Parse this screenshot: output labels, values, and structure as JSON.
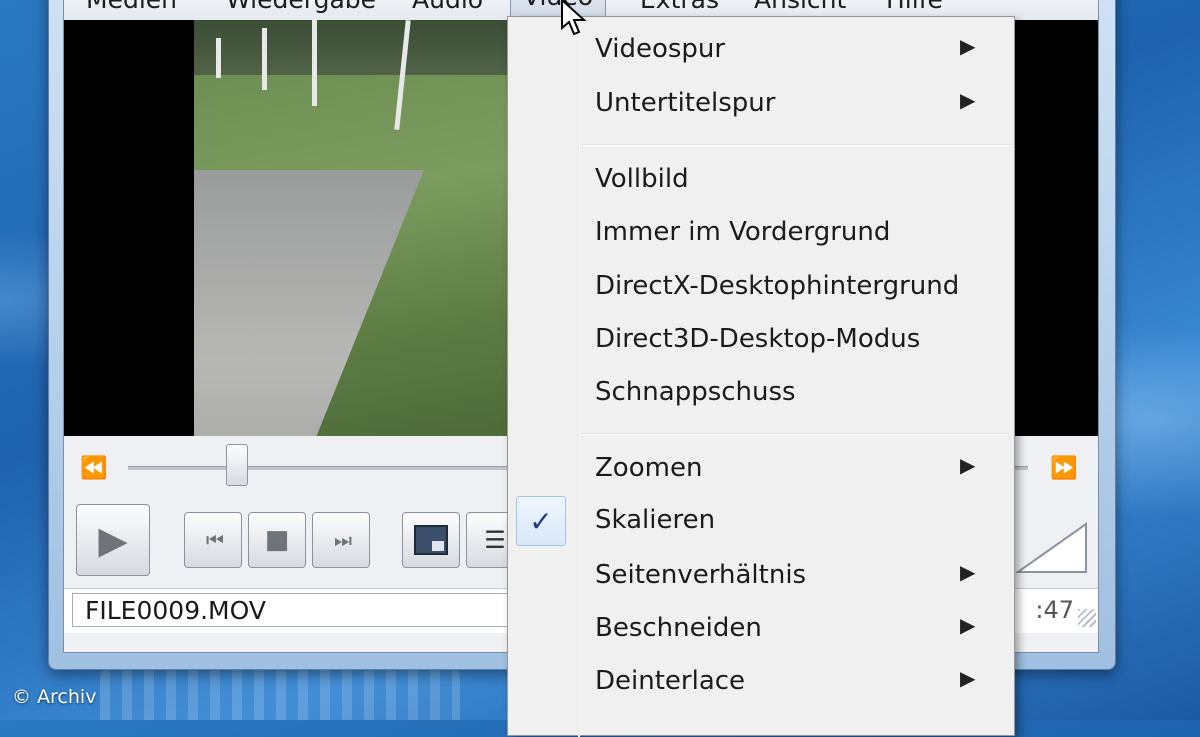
{
  "menubar": {
    "items": [
      {
        "label": "Medien"
      },
      {
        "label": "Wiedergabe"
      },
      {
        "label": "Audio"
      },
      {
        "label": "Video"
      },
      {
        "label": "Extras"
      },
      {
        "label": "Ansicht"
      },
      {
        "label": "Hilfe"
      }
    ]
  },
  "context_menu": {
    "items": [
      {
        "label": "Videospur",
        "submenu": true
      },
      {
        "label": "Untertitelspur",
        "submenu": true
      },
      {
        "label": "Vollbild",
        "submenu": false
      },
      {
        "label": "Immer im Vordergrund",
        "submenu": false
      },
      {
        "label": "DirectX-Desktophintergrund",
        "submenu": false
      },
      {
        "label": "Direct3D-Desktop-Modus",
        "submenu": false
      },
      {
        "label": "Schnappschuss",
        "submenu": false
      },
      {
        "label": "Zoomen",
        "submenu": true
      },
      {
        "label": "Skalieren",
        "submenu": false,
        "checked": true
      },
      {
        "label": "Seitenverhältnis",
        "submenu": true
      },
      {
        "label": "Beschneiden",
        "submenu": true
      },
      {
        "label": "Deinterlace",
        "submenu": true
      }
    ],
    "check_mark": "✓",
    "submenu_arrow": "▶"
  },
  "player": {
    "seek_back_icon": "⏪",
    "seek_forward_icon": "⏩",
    "play_icon": "▶",
    "prev_icon": "⏮",
    "stop_icon": "■",
    "next_icon": "⏭",
    "playlist_icon": "☰",
    "seek_position": 0.12
  },
  "status": {
    "filename": "FILE0009.MOV",
    "time_fragment": ":47"
  },
  "credit": "© Archiv",
  "colors": {
    "desktop": "#2a78c2",
    "menu_background": "#f0f0f0",
    "check_color": "#1f3c8a"
  }
}
